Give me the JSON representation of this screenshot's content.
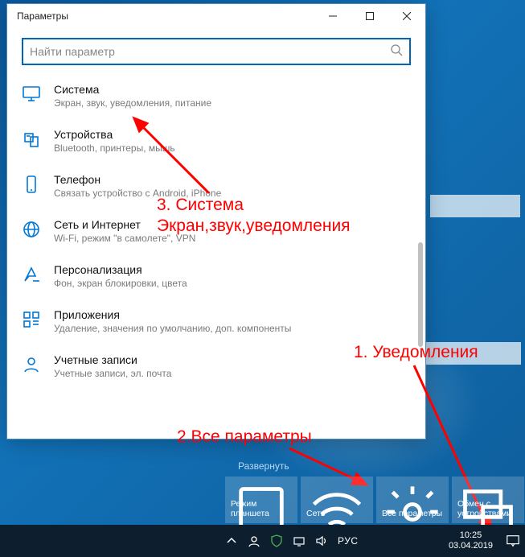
{
  "window": {
    "title": "Параметры",
    "search_placeholder": "Найти параметр"
  },
  "categories": [
    {
      "icon": "monitor",
      "title": "Система",
      "desc": "Экран, звук, уведомления, питание"
    },
    {
      "icon": "devices",
      "title": "Устройства",
      "desc": "Bluetooth, принтеры, мышь"
    },
    {
      "icon": "phone",
      "title": "Телефон",
      "desc": "Связать устройство с Android, iPhone"
    },
    {
      "icon": "globe",
      "title": "Сеть и Интернет",
      "desc": "Wi-Fi, режим \"в самолете\", VPN"
    },
    {
      "icon": "personal",
      "title": "Персонализация",
      "desc": "Фон, экран блокировки, цвета"
    },
    {
      "icon": "apps",
      "title": "Приложения",
      "desc": "Удаление, значения по умолчанию, доп. компоненты"
    },
    {
      "icon": "accounts",
      "title": "Учетные записи",
      "desc": "Учетные записи, эл. почта"
    }
  ],
  "annotations": {
    "a1": "1. Уведомления",
    "a2": "2.Все параметры",
    "a3_line1": "3. Система",
    "a3_line2": "Экран,звук,уведомления"
  },
  "action_center": {
    "expand": "Развернуть",
    "tiles": [
      {
        "icon": "tablet",
        "label": "Режим планшета"
      },
      {
        "icon": "network",
        "label": "Сеть"
      },
      {
        "icon": "gear",
        "label": "Все параметры"
      },
      {
        "icon": "connect",
        "label": "Обмен с устройствами"
      }
    ]
  },
  "taskbar": {
    "lang": "РУС",
    "time": "10:25",
    "date": "03.04.2019"
  }
}
